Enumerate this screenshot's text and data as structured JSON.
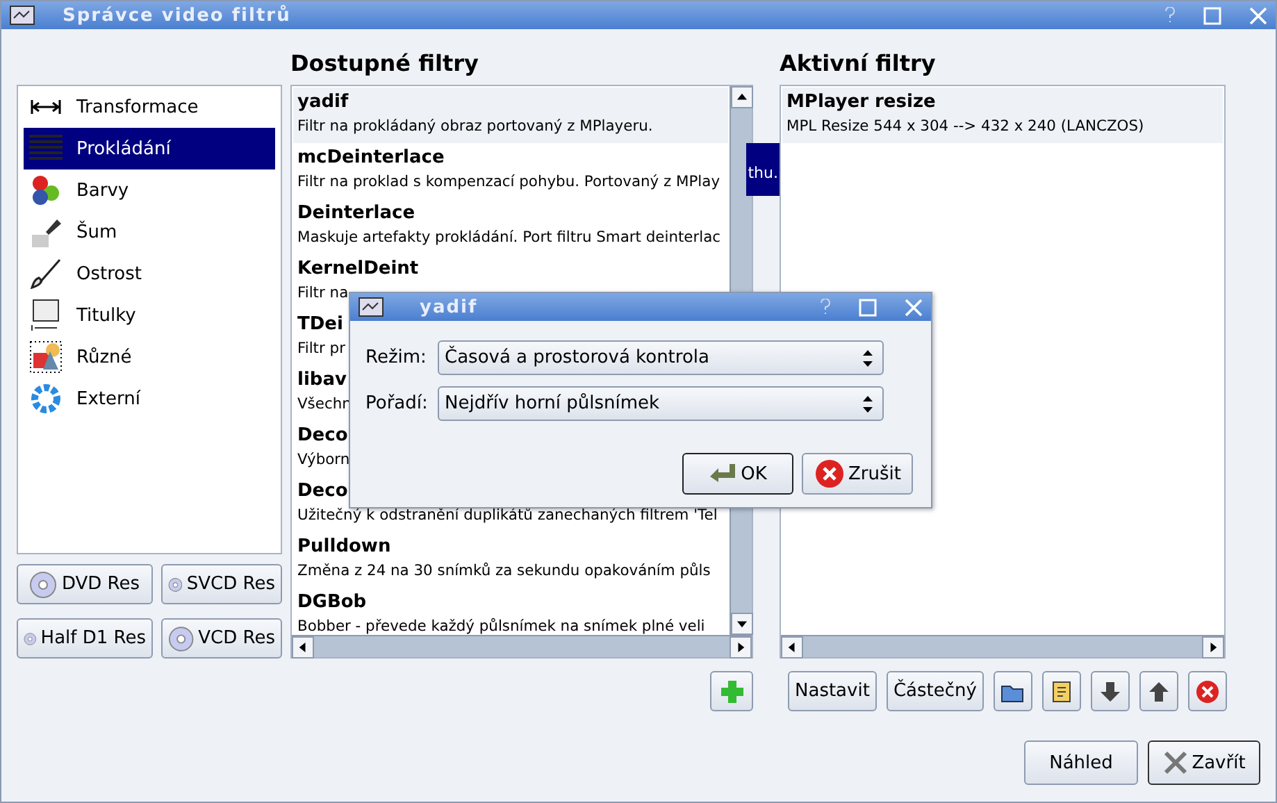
{
  "window": {
    "title": "Správce video filtrů"
  },
  "categories": [
    {
      "label": "Transformace",
      "kind": "transform",
      "selected": false
    },
    {
      "label": "Prokládání",
      "kind": "interlace",
      "selected": true
    },
    {
      "label": "Barvy",
      "kind": "colors",
      "selected": false
    },
    {
      "label": "Šum",
      "kind": "noise",
      "selected": false
    },
    {
      "label": "Ostrost",
      "kind": "sharpen",
      "selected": false
    },
    {
      "label": "Titulky",
      "kind": "subtitles",
      "selected": false
    },
    {
      "label": "Různé",
      "kind": "misc",
      "selected": false
    },
    {
      "label": "Externí",
      "kind": "external",
      "selected": false
    }
  ],
  "presets": [
    "DVD Res",
    "SVCD Res",
    "Half D1 Res",
    "VCD Res"
  ],
  "available": {
    "heading": "Dostupné filtry",
    "items": [
      {
        "name": "yadif",
        "description": "Filtr na prokládaný obraz portovaný z MPlayeru.",
        "selected": true
      },
      {
        "name": "mcDeinterlace",
        "description": "Filtr na proklad s kompenzací pohybu. Portovaný z MPlay",
        "selected": false
      },
      {
        "name": "Deinterlace",
        "description": "Maskuje artefakty prokládání. Port filtru Smart deinterlac",
        "selected": false
      },
      {
        "name": "KernelDeint",
        "description": "Filtr na",
        "selected": false
      },
      {
        "name": "TDei",
        "description": "Filtr pr",
        "selected": false
      },
      {
        "name": "libav",
        "description": "Všechn",
        "selected": false
      },
      {
        "name": "Deco",
        "description": "Výborn",
        "selected": false
      },
      {
        "name": "Deco",
        "description": "Užitečný k odstranění duplikátů zanechaných filtrem 'Tel",
        "selected": false
      },
      {
        "name": "Pulldown",
        "description": "Změna z 24 na 30 snímků za sekundu opakováním půls",
        "selected": false
      },
      {
        "name": "DGBob",
        "description": "Bobber - převede každý půlsnímek na snímek plné veli",
        "selected": false
      }
    ],
    "tooltip": "thu."
  },
  "active": {
    "heading": "Aktivní filtry",
    "items": [
      {
        "name": "MPlayer resize",
        "description": "MPL Resize 544 x 304 --> 432 x 240 (LANCZOS)",
        "selected": true
      }
    ]
  },
  "filter_buttons": [
    {
      "kind": "text",
      "label": "Nastavit"
    },
    {
      "kind": "text",
      "label": "Částečný"
    },
    {
      "kind": "open"
    },
    {
      "kind": "edit"
    },
    {
      "kind": "down"
    },
    {
      "kind": "up"
    },
    {
      "kind": "remove"
    }
  ],
  "footer_buttons": [
    {
      "label": "Náhled",
      "kind": "preview"
    },
    {
      "label": "Zavřít",
      "kind": "close"
    }
  ],
  "dialog": {
    "title": "yadif",
    "fields": [
      {
        "label": "Režim:",
        "value": "Časová a prostorová kontrola"
      },
      {
        "label": "Pořadí:",
        "value": "Nejdřív horní půlsnímek"
      }
    ],
    "buttons": [
      {
        "label": "OK",
        "kind": "ok"
      },
      {
        "label": "Zrušit",
        "kind": "cancel"
      }
    ]
  }
}
